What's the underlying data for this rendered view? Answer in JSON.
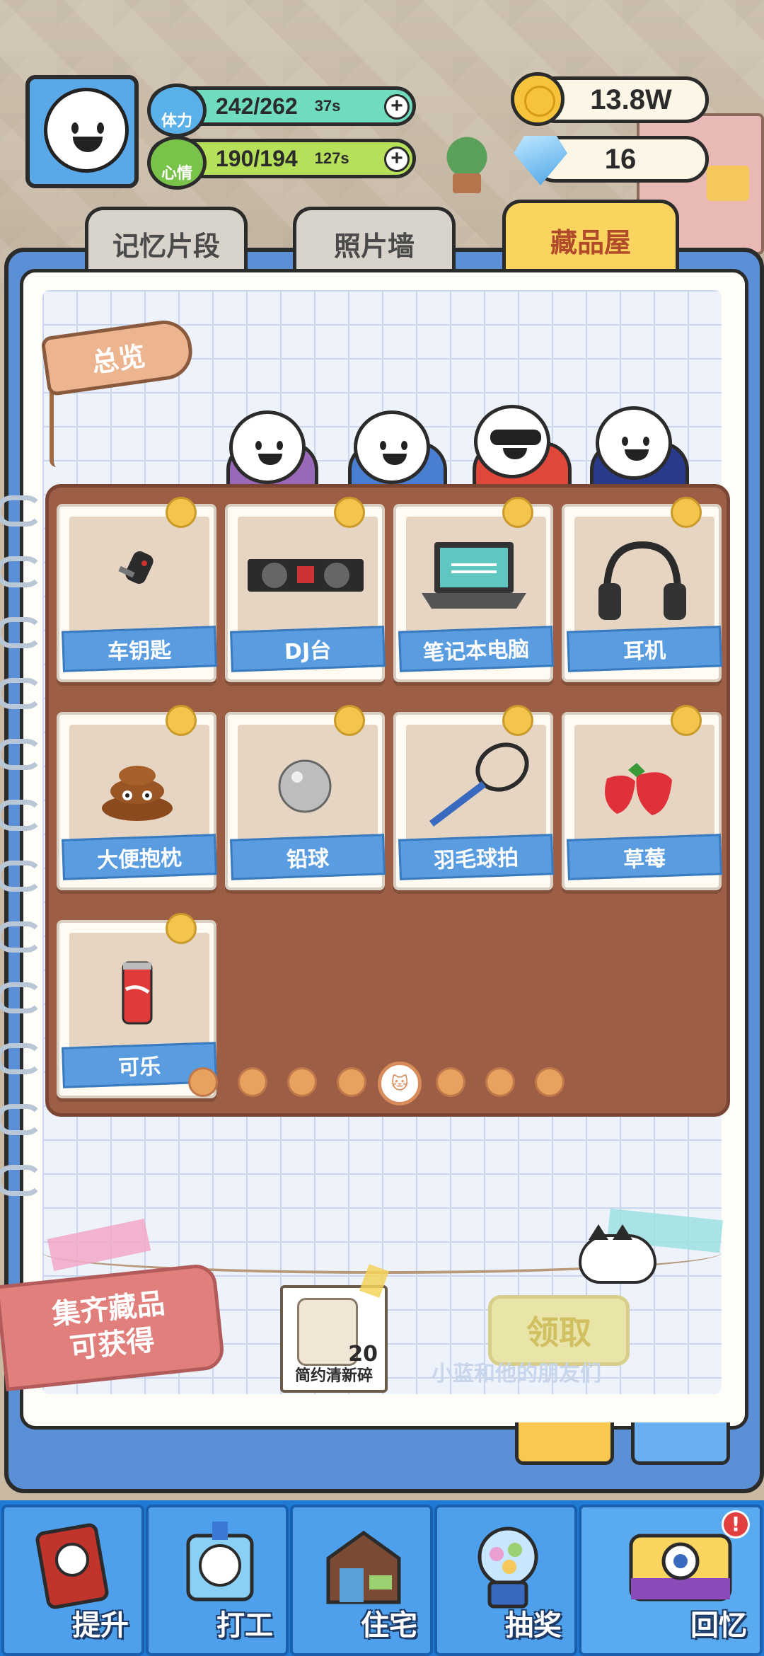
{
  "header": {
    "stamina": {
      "label": "体力",
      "value": "242/262",
      "timer": "37s",
      "color": "#6fdcc0"
    },
    "mood": {
      "label": "心情",
      "value": "190/194",
      "timer": "127s",
      "color": "#b6e05a"
    },
    "coins": {
      "value": "13.8W",
      "icon": "coin-icon"
    },
    "gems": {
      "value": "16",
      "icon": "diamond-icon"
    }
  },
  "tabs": [
    {
      "label": "记忆片段",
      "active": false
    },
    {
      "label": "照片墙",
      "active": false
    },
    {
      "label": "藏品屋",
      "active": true
    }
  ],
  "overview_tag": "总览",
  "collection": {
    "items": [
      {
        "label": "车钥匙",
        "icon": "car-key-icon"
      },
      {
        "label": "DJ台",
        "icon": "dj-deck-icon"
      },
      {
        "label": "笔记本电脑",
        "icon": "laptop-icon"
      },
      {
        "label": "耳机",
        "icon": "headphones-icon"
      },
      {
        "label": "大便抱枕",
        "icon": "poop-pillow-icon"
      },
      {
        "label": "铅球",
        "icon": "shot-put-icon"
      },
      {
        "label": "羽毛球拍",
        "icon": "badminton-racket-icon"
      },
      {
        "label": "草莓",
        "icon": "strawberry-icon"
      },
      {
        "label": "可乐",
        "icon": "cola-can-icon"
      }
    ],
    "page_count": 8,
    "active_page": 4
  },
  "reward": {
    "tag_line1": "集齐藏品",
    "tag_line2": "可获得",
    "item_name": "简约清新碎",
    "item_count": "20",
    "claim_label": "领取",
    "faint_caption": "小蓝和他的朋友们"
  },
  "nav": [
    {
      "label": "提升",
      "icon": "book-icon"
    },
    {
      "label": "打工",
      "icon": "work-badge-icon"
    },
    {
      "label": "住宅",
      "icon": "house-icon"
    },
    {
      "label": "抽奖",
      "icon": "gacha-machine-icon"
    },
    {
      "label": "回忆",
      "icon": "camera-icon",
      "badge": "!"
    }
  ]
}
